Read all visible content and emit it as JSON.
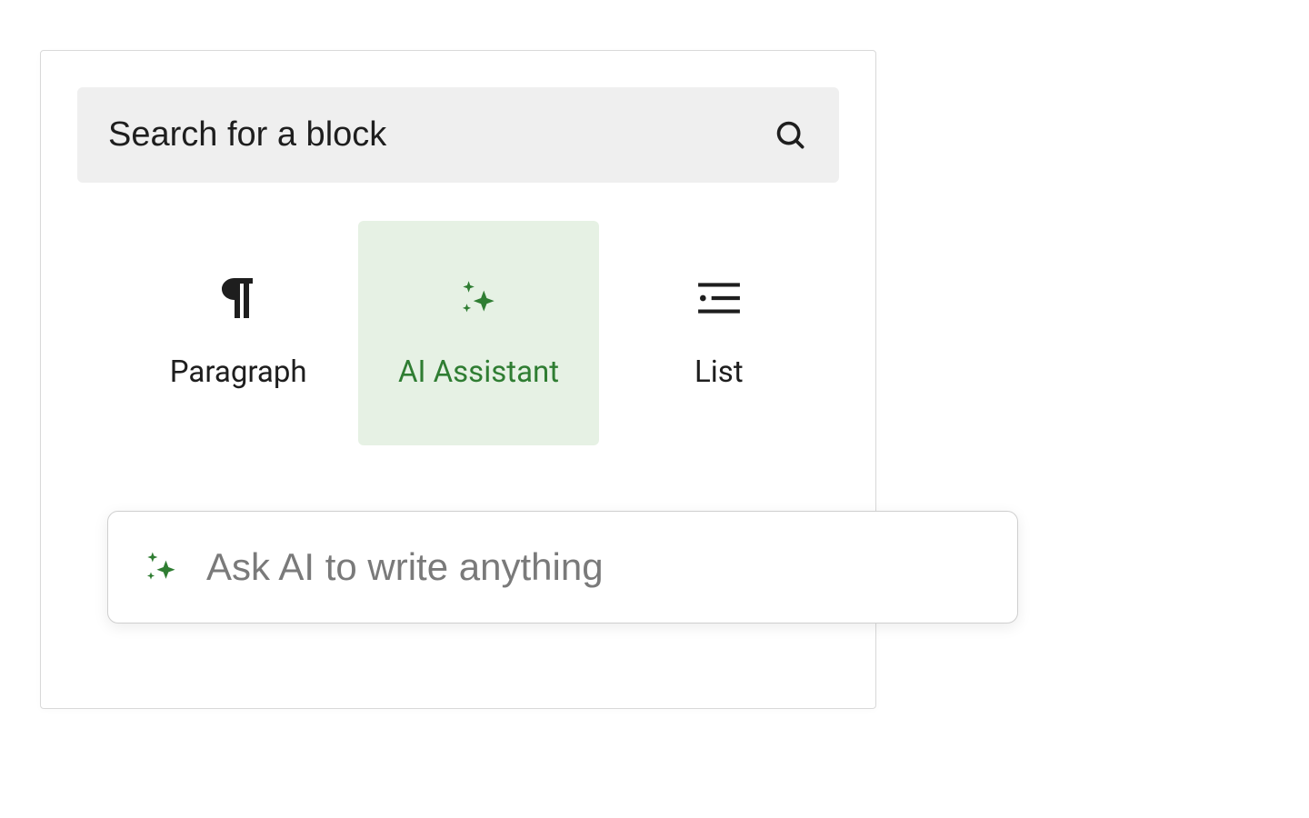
{
  "search": {
    "placeholder": "Search for a block"
  },
  "blocks": {
    "items": [
      {
        "label": "Paragraph"
      },
      {
        "label": "AI Assistant"
      },
      {
        "label": "List"
      }
    ]
  },
  "ask": {
    "placeholder": "Ask AI to write anything"
  },
  "colors": {
    "accent": "#2f7d32",
    "selected_bg": "#e6f1e4"
  }
}
